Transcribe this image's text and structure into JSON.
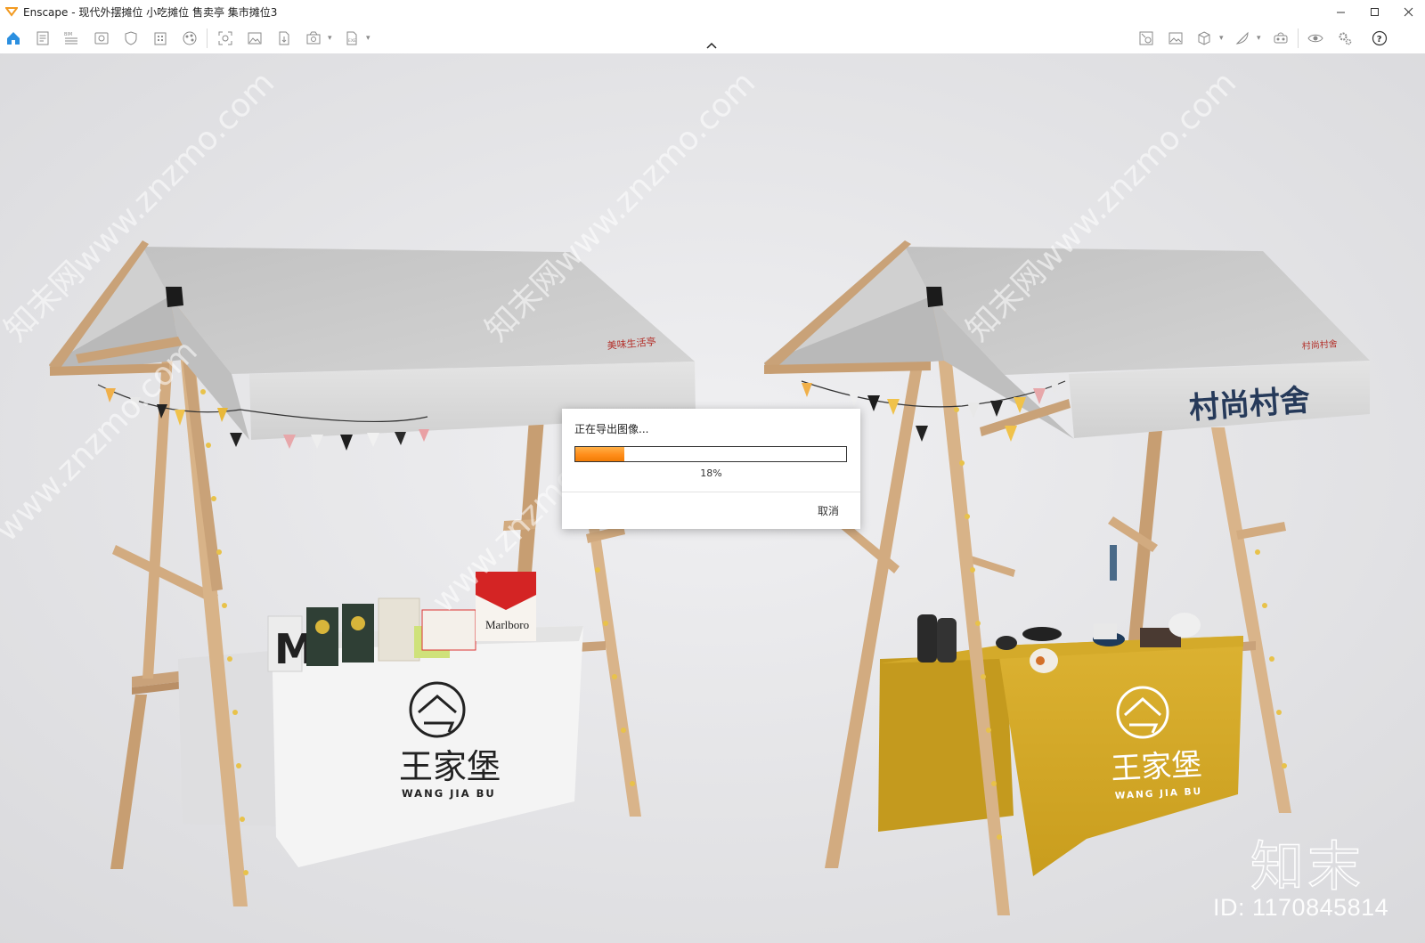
{
  "window": {
    "app_name": "Enscape",
    "title": "Enscape - 现代外摆摊位 小吃摊位 售卖亭 集市摊位3",
    "accent_color": "#f29a21"
  },
  "toolbar": {
    "left_icons": [
      "home-icon",
      "document-icon",
      "bim-icon",
      "visual-settings-icon",
      "shield-icon",
      "building-icon",
      "materials-icon",
      "screenshot-icon",
      "image-icon",
      "export-file-icon",
      "batch-render-icon",
      "exe-export-icon"
    ],
    "right_icons": [
      "asset-library-icon",
      "image-gallery-icon",
      "cube-view-icon",
      "feather-icon",
      "vr-headset-icon",
      "eye-icon",
      "settings-icon",
      "help-icon"
    ]
  },
  "scene": {
    "left_stall": {
      "cloth_brand": "王家堡",
      "cloth_subtitle": "WANG JIA BU",
      "roof_sign": "美味生活亭",
      "product_brand": "Marlboro",
      "canopy_color": "#c9c9c9",
      "cloth_color": "#f2f2f2"
    },
    "right_stall": {
      "roof_logo": "村尚村舍",
      "roof_sign": "村尚村舍",
      "cloth_brand": "王家堡",
      "cloth_subtitle": "WANG JIA BU",
      "cloth_color": "#d6ac2a"
    },
    "watermarks": [
      "知末网www.znzmo.com",
      "知末网www.znzmo.com",
      "知末网www.znzmo.com",
      "www.znzmo.com",
      "www.znzmo.com"
    ],
    "brand_mark": "知末",
    "id_text": "ID: 1170845814"
  },
  "export_dialog": {
    "title": "正在导出图像...",
    "progress_percent": 18,
    "progress_label": "18%",
    "cancel_label": "取消",
    "progress_color": "#ff8d1a"
  }
}
